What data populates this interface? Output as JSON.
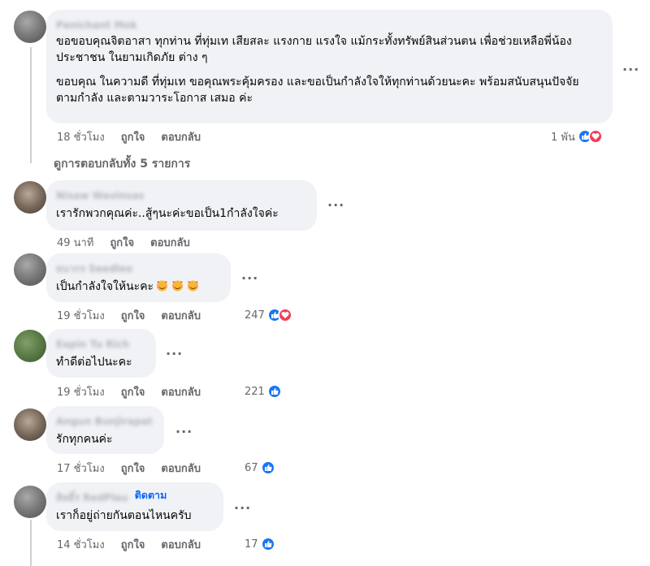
{
  "comments": [
    {
      "name": "Panichant Mok",
      "text": [
        "ขอขอบคุณจิตอาสา ทุกท่าน ที่ทุ่มเท เสียสละ แรงกาย แรงใจ แม้กระทั้งทรัพย์สินส่วนตน เพื่อช่วยเหลือพี่น้อง ประชาชน ในยามเกิดภัย ต่าง ๆ",
        "ขอบคุณ ในความดี ที่ทุ่มเท ขอคุณพระคุ้มครอง และขอเป็นกำลังใจให้ทุกท่านด้วยนะคะ พร้อมสนับสนุนปัจจัย ตามกำลัง และตามวาระโอกาส เสมอ ค่ะ"
      ],
      "time": "18 ชั่วโมง",
      "like": "ถูกใจ",
      "reply": "ตอบกลับ",
      "reaction_count": "1 พัน",
      "reactions": [
        "like",
        "love"
      ]
    },
    {
      "name": "Nisaw Wavinsas",
      "text": [
        "เรารักพวกคุณค่ะ..สู้ๆนะค่ะขอเป็น1กำลังใจค่ะ"
      ],
      "time": "49 นาที",
      "like": "ถูกใจ",
      "reply": "ตอบกลับ",
      "reaction_count": "",
      "reactions": []
    },
    {
      "name": "ธนากร Seedleo",
      "text": [
        "เป็นกำลังใจให้นะคะ"
      ],
      "emoji_count": 3,
      "time": "19 ชั่วโมง",
      "like": "ถูกใจ",
      "reply": "ตอบกลับ",
      "reaction_count": "247",
      "reactions": [
        "like",
        "love"
      ]
    },
    {
      "name": "Eapin Tu Rich",
      "text": [
        "ทำดีต่อไปนะคะ"
      ],
      "time": "19 ชั่วโมง",
      "like": "ถูกใจ",
      "reply": "ตอบกลับ",
      "reaction_count": "221",
      "reactions": [
        "like"
      ]
    },
    {
      "name": "Angun Bunjirapat",
      "text": [
        "รักทุกคนค่ะ"
      ],
      "time": "17 ชั่วโมง",
      "like": "ถูกใจ",
      "reply": "ตอบกลับ",
      "reaction_count": "67",
      "reactions": [
        "like"
      ]
    },
    {
      "name": "สิทธิ์ร RedPlau",
      "follow": "ติดตาม",
      "text": [
        "เราก็อยู่ถ่ายกันตอนไหนครับ"
      ],
      "time": "14 ชั่วโมง",
      "like": "ถูกใจ",
      "reply": "ตอบกลับ",
      "reaction_count": "17",
      "reactions": [
        "like"
      ]
    }
  ],
  "view_replies": "ดูการตอบกลับทั้ง 5 รายการ",
  "colors": {
    "bubble": "#f0f2f5",
    "meta": "#65676b",
    "like_blue": "#1877f2",
    "love_red": "#f33e58",
    "follow_blue": "#0866ff"
  }
}
